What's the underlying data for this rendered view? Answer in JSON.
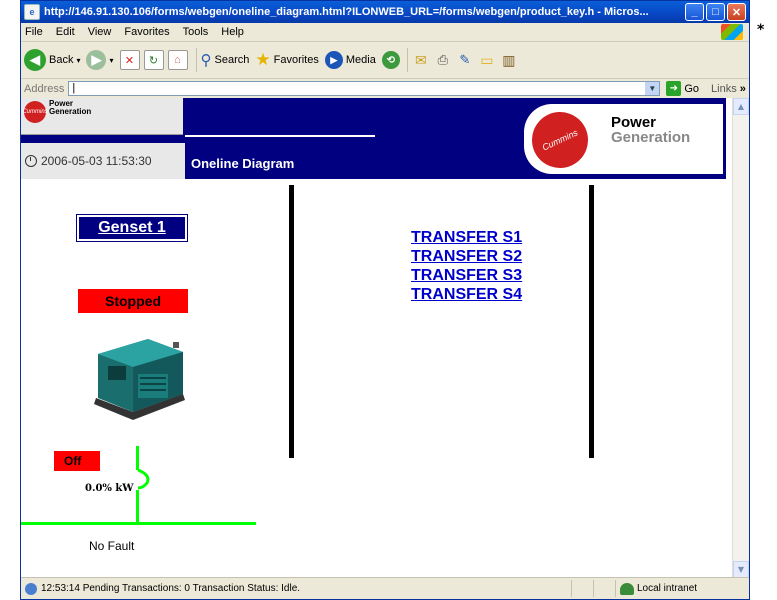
{
  "window": {
    "title": "http://146.91.130.106/forms/webgen/oneline_diagram.html?ILONWEB_URL=/forms/webgen/product_key.h - Micros...",
    "buttons": [
      "_",
      "□",
      "✕"
    ]
  },
  "menu": {
    "items": [
      "File",
      "Edit",
      "View",
      "Favorites",
      "Tools",
      "Help"
    ]
  },
  "toolbar": {
    "back_label": "Back",
    "search_label": "Search",
    "favorites_label": "Favorites",
    "media_label": "Media"
  },
  "address": {
    "label": "Address",
    "value": "|",
    "go_label": "Go",
    "links_label": "Links"
  },
  "page": {
    "small_logo_line1": "Power",
    "small_logo_line2": "Generation",
    "small_logo_mark": "Cummins",
    "datetime": "2006-05-03 11:53:30",
    "title": "Oneline Diagram",
    "brand_line1": "Power",
    "brand_line2": "Generation",
    "brand_mark": "Cummins",
    "genset_label": "Genset 1",
    "status_label": "Stopped",
    "transfers": [
      "TRANSFER S1",
      "TRANSFER S2",
      "TRANSFER S3",
      "TRANSFER S4"
    ],
    "breaker_state": "Off",
    "power": "0.0% kW",
    "fault": "No Fault"
  },
  "statusbar": {
    "text": "12:53:14 Pending Transactions: 0 Transaction Status: Idle.",
    "zone": "Local intranet"
  },
  "colors": {
    "header_bg": "#000080",
    "status_red": "#ff0000",
    "bus_green": "#00ff00",
    "link_blue": "#0000cc"
  }
}
